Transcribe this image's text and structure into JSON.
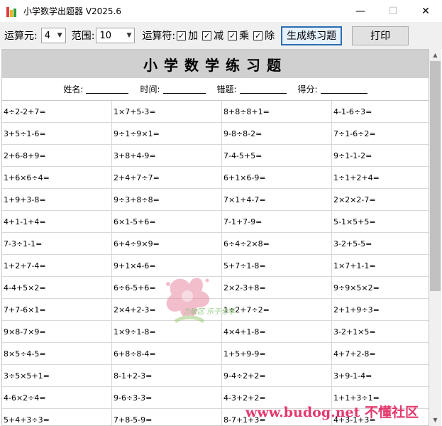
{
  "window": {
    "title": "小学数学出题器 V2025.6",
    "min_label": "—",
    "max_label": "☐",
    "close_label": "✕"
  },
  "toolbar": {
    "operands_label": "运算元:",
    "operands_value": "4",
    "range_label": "范围:",
    "range_value": "10",
    "operators_label": "运算符:",
    "operators": [
      {
        "label": "加",
        "checked": true
      },
      {
        "label": "减",
        "checked": true
      },
      {
        "label": "乘",
        "checked": true
      },
      {
        "label": "除",
        "checked": true
      }
    ],
    "generate_label": "生成练习题",
    "print_label": "打印"
  },
  "sheet": {
    "title": "小学数学练习题",
    "name_label": "姓名:",
    "time_label": "时间:",
    "errors_label": "错题:",
    "score_label": "得分:",
    "problems": [
      [
        "4÷2-2+7=",
        "1×7+5-3=",
        "8+8÷8+1=",
        "4-1-6÷3="
      ],
      [
        "3+5÷1-6=",
        "9÷1÷9×1=",
        "9-8÷8-2=",
        "7÷1-6÷2="
      ],
      [
        "2+6-8+9=",
        "3+8+4-9=",
        "7-4-5+5=",
        "9÷1-1-2="
      ],
      [
        "1+6×6÷4=",
        "2+4+7÷7=",
        "6+1×6-9=",
        "1÷1+2+4="
      ],
      [
        "1+9+3-8=",
        "9÷3+8÷8=",
        "7×1+4-7=",
        "2×2×2-7="
      ],
      [
        "4+1-1+4=",
        "6×1-5+6=",
        "7-1+7-9=",
        "5-1×5+5="
      ],
      [
        "7-3÷1-1=",
        "6+4÷9×9=",
        "6÷4÷2×8=",
        "3-2+5-5="
      ],
      [
        "1+2+7-4=",
        "9+1×4-6=",
        "5+7÷1-8=",
        "1×7+1-1="
      ],
      [
        "4-4+5×2=",
        "6÷6-5+6=",
        "2×2-3+8=",
        "9÷9×5×2="
      ],
      [
        "7+7-6×1=",
        "2×4+2-3=",
        "1÷2+7÷2=",
        "2+1+9÷3="
      ],
      [
        "9×8-7×9=",
        "1×9÷1-8=",
        "4×4+1-8=",
        "3-2+1×5="
      ],
      [
        "8×5÷4-5=",
        "6+8÷8-4=",
        "1+5+9-9=",
        "4+7+2-8="
      ],
      [
        "3÷5×5+1=",
        "8-1+2-3=",
        "9-4÷2+2=",
        "3+9-1-4="
      ],
      [
        "4-6×2÷4=",
        "9-6÷3-3=",
        "4-3+2+2=",
        "1+1+3÷1="
      ],
      [
        "5+4+3÷3=",
        "7+8-5-9=",
        "8-7+1+3=",
        "4+3-1+3="
      ]
    ]
  },
  "watermark": {
    "logo_text": "力破区 乐于分享",
    "bottom_text": "www.budog.net 不懂社区"
  }
}
